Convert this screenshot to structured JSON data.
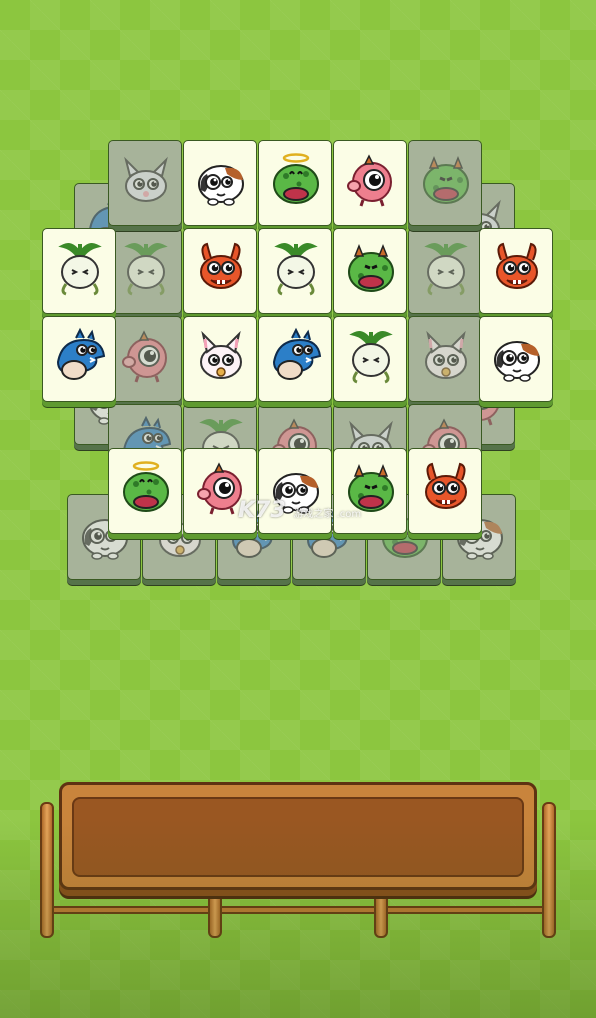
{
  "game": {
    "watermark_text": "K73",
    "watermark_sub": "游戏之家 .com",
    "colors": {
      "background": "#8cc63f",
      "tile_face": "#fbfde6",
      "tile_blocked": "#a7b39a",
      "tray_wood": "#c9843c"
    },
    "tiles": [
      {
        "col": 1,
        "row": 0,
        "creature": "cat-icon",
        "state": "blocked"
      },
      {
        "col": 2,
        "row": 0,
        "creature": "calico-pup-icon",
        "state": "free"
      },
      {
        "col": 3,
        "row": 0,
        "creature": "green-angel-blob-icon",
        "state": "free"
      },
      {
        "col": 4,
        "row": 0,
        "creature": "pink-pig-icon",
        "state": "free"
      },
      {
        "col": 5,
        "row": 0,
        "creature": "green-blob-icon",
        "state": "blocked"
      },
      {
        "col": 2,
        "row": 1,
        "creature": "orange-fish-icon",
        "state": "free"
      },
      {
        "col": 3,
        "row": 1,
        "creature": "turnip-icon",
        "state": "free"
      },
      {
        "col": 4,
        "row": 1,
        "creature": "green-blob-icon",
        "state": "free"
      },
      {
        "col": 2,
        "row": 2,
        "creature": "white-bunny-icon",
        "state": "free"
      },
      {
        "col": 3,
        "row": 2,
        "creature": "blue-shark-icon",
        "state": "free"
      },
      {
        "col": 4,
        "row": 2,
        "creature": "turnip-icon",
        "state": "free"
      },
      {
        "col": 0,
        "row": 1,
        "creature": "turnip-icon",
        "state": "free"
      },
      {
        "col": 0,
        "row": 2,
        "creature": "blue-shark-icon",
        "state": "free"
      },
      {
        "col": 6,
        "row": 1,
        "creature": "orange-fish-icon",
        "state": "free"
      },
      {
        "col": 6,
        "row": 2,
        "creature": "calico-pup-icon",
        "state": "free"
      },
      {
        "col": 1,
        "row": 3,
        "creature": "green-angel-blob-icon",
        "state": "free"
      },
      {
        "col": 2,
        "row": 3,
        "creature": "pink-pig-icon",
        "state": "free"
      },
      {
        "col": 3,
        "row": 3,
        "creature": "calico-pup-icon",
        "state": "free"
      },
      {
        "col": 4,
        "row": 3,
        "creature": "green-blob-icon",
        "state": "free"
      },
      {
        "col": 5,
        "row": 3,
        "creature": "orange-fish-icon",
        "state": "free"
      }
    ],
    "tray": {
      "slots": 7,
      "filled": 0
    }
  }
}
